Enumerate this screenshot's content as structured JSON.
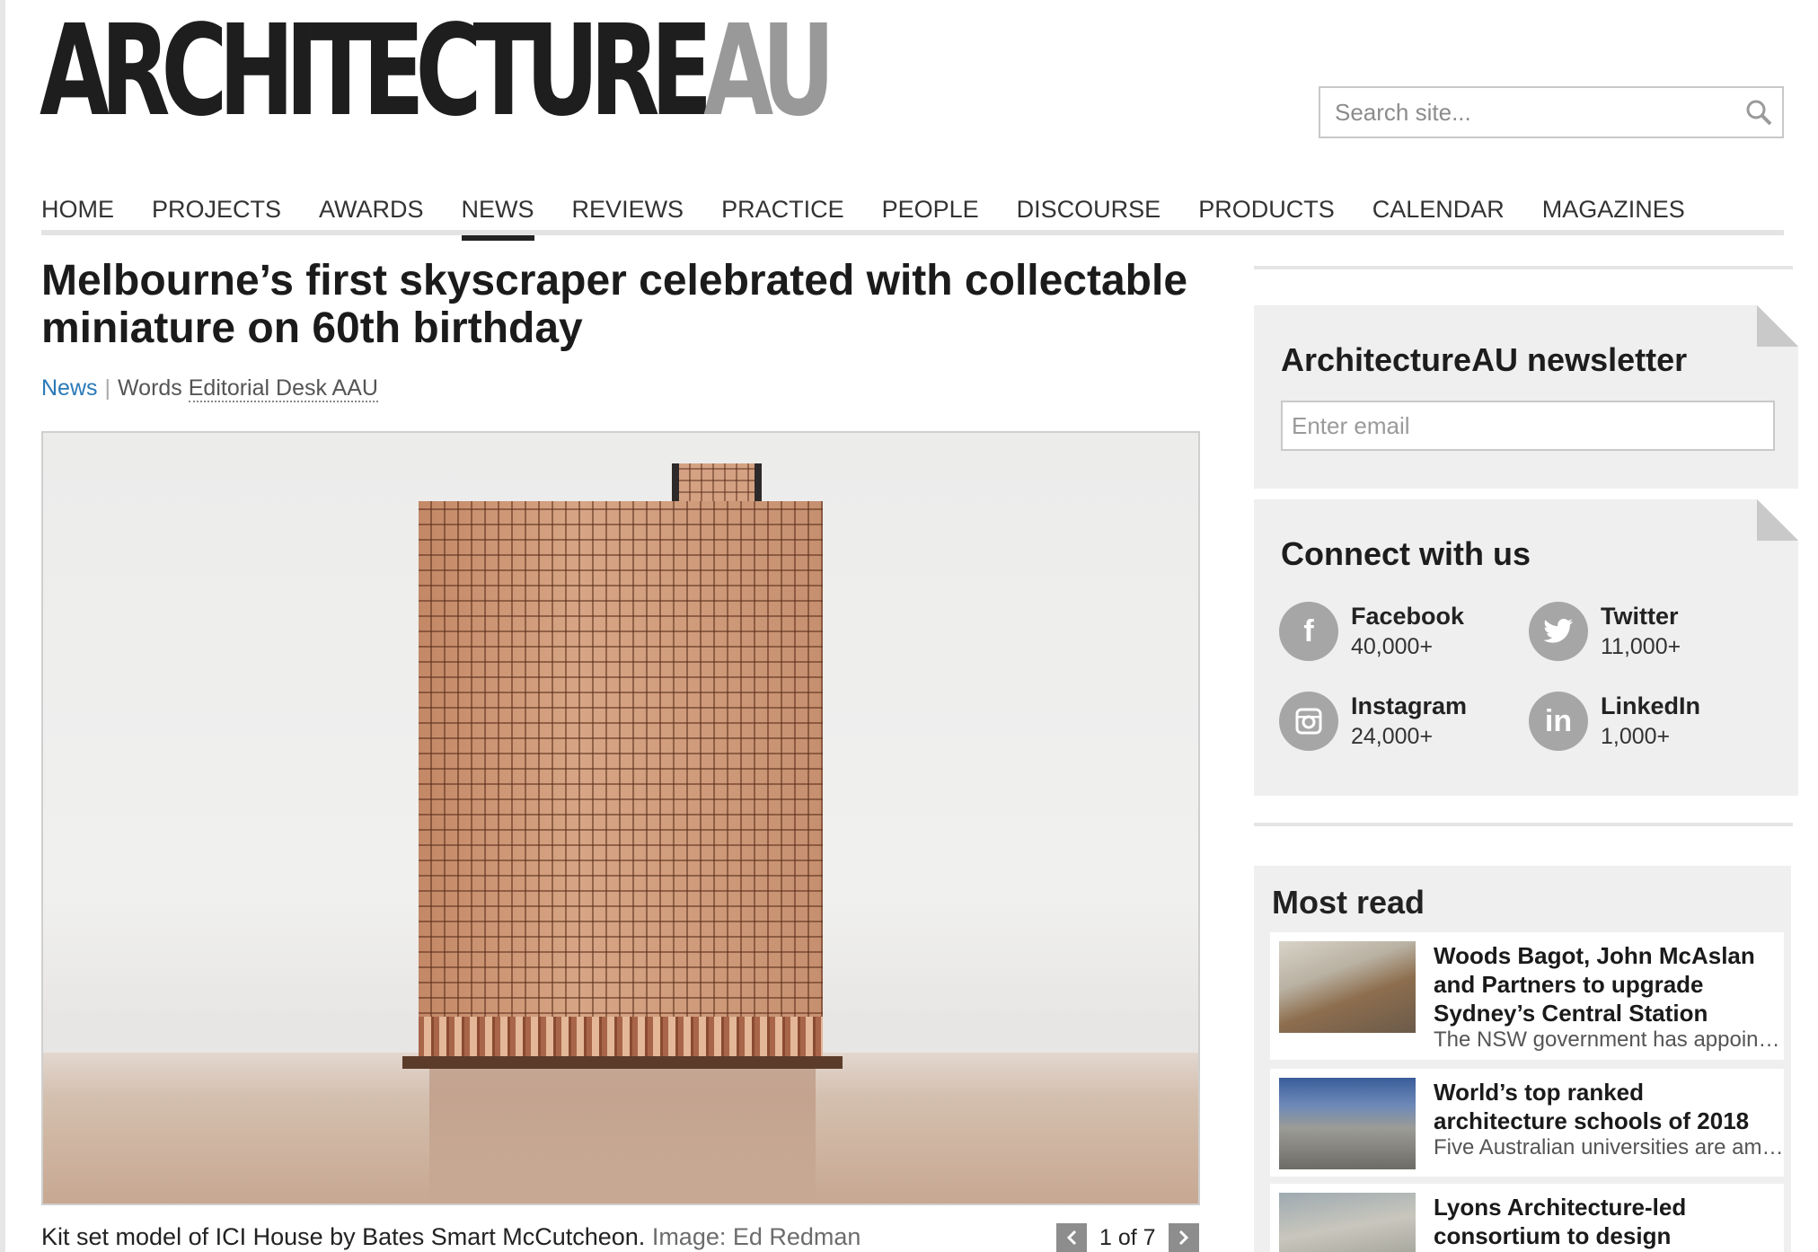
{
  "logo": {
    "main": "ARCHITECTURE",
    "accent": "AU"
  },
  "search": {
    "placeholder": "Search site..."
  },
  "nav": {
    "items": [
      "HOME",
      "PROJECTS",
      "AWARDS",
      "NEWS",
      "REVIEWS",
      "PRACTICE",
      "PEOPLE",
      "DISCOURSE",
      "PRODUCTS",
      "CALENDAR",
      "MAGAZINES"
    ],
    "active": "NEWS"
  },
  "article": {
    "title": "Melbourne’s first skyscraper celebrated with collectable miniature on 60th birthday",
    "category": "News",
    "words_label": "Words",
    "author": "Editorial Desk AAU",
    "caption": "Kit set model of ICI House by Bates Smart McCutcheon.",
    "credit": "Image: Ed Redman",
    "pager": "1 of 7"
  },
  "newsletter": {
    "title": "ArchitectureAU newsletter",
    "placeholder": "Enter email"
  },
  "connect": {
    "title": "Connect with us",
    "items": [
      {
        "name": "Facebook",
        "count": "40,000+",
        "icon": "facebook-icon"
      },
      {
        "name": "Twitter",
        "count": "11,000+",
        "icon": "twitter-icon"
      },
      {
        "name": "Instagram",
        "count": "24,000+",
        "icon": "instagram-icon"
      },
      {
        "name": "LinkedIn",
        "count": "1,000+",
        "icon": "linkedin-icon"
      }
    ]
  },
  "most_read": {
    "title": "Most read",
    "items": [
      {
        "title": "Woods Bagot, John McAslan and Partners to upgrade Sydney’s Central Station",
        "desc": "The NSW government has appointed"
      },
      {
        "title": "World’s top ranked architecture schools of 2018",
        "desc": "Five Australian universities are among"
      },
      {
        "title": "Lyons Architecture-led consortium to design Melbourne Uni",
        "desc": ""
      }
    ]
  },
  "colors": {
    "link": "#2a79b7",
    "logo_accent": "#999999",
    "panel": "#efefef"
  }
}
